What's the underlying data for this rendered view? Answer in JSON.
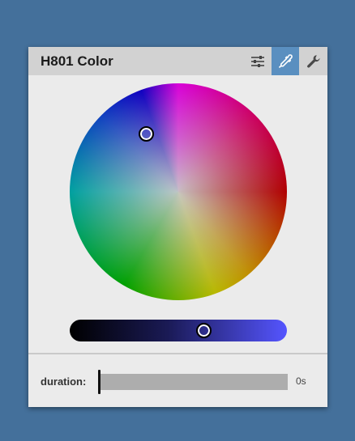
{
  "panel": {
    "title": "H801 Color",
    "buttons": [
      {
        "name": "sliders-icon",
        "active": false
      },
      {
        "name": "eyedropper-icon",
        "active": true
      },
      {
        "name": "wrench-icon",
        "active": false
      }
    ]
  },
  "color": {
    "brightness_gradient": [
      "#000000",
      "#5555ff"
    ]
  },
  "duration": {
    "label": "duration:",
    "value": "0s"
  },
  "colors": {
    "background": "#44709b",
    "panel": "#ebebeb",
    "header": "#d2d2d2",
    "active_button": "#5a8fc0"
  }
}
